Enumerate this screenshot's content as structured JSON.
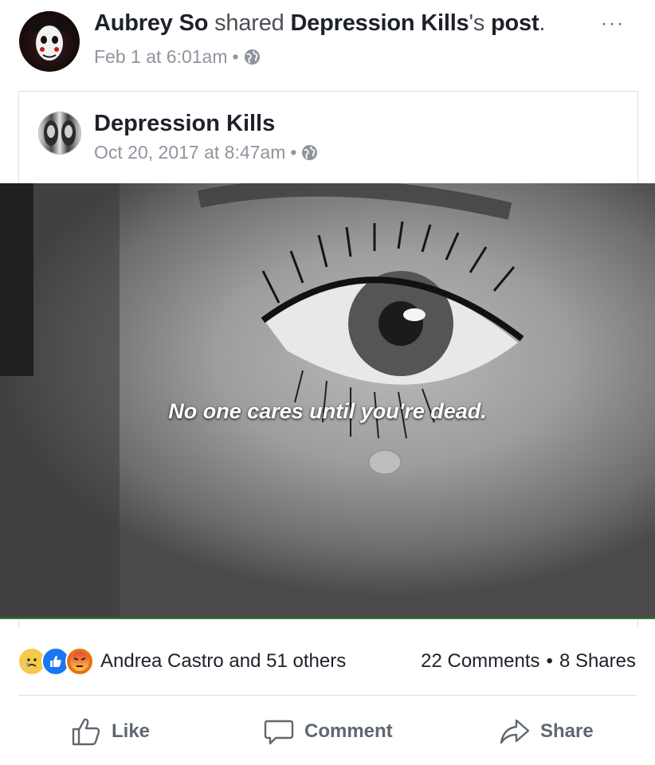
{
  "post": {
    "sharer_name": "Aubrey So",
    "shared_word": "shared",
    "shared_page": "Depression Kills",
    "possessive": "'s",
    "post_word": "post",
    "period": ".",
    "timestamp": "Feb 1 at 6:01am",
    "dot": "•",
    "menu": "···"
  },
  "shared_post": {
    "page_name": "Depression Kills",
    "timestamp": "Oct 20, 2017 at 8:47am",
    "dot": "•",
    "image_caption": "No one cares until you're dead."
  },
  "reactions": {
    "icons": [
      "sad-reaction-icon",
      "like-reaction-icon",
      "angry-reaction-icon"
    ],
    "summary": "Andrea Castro and 51 others",
    "comments": "22 Comments",
    "separator": "•",
    "shares": "8 Shares"
  },
  "actions": {
    "like": "Like",
    "comment": "Comment",
    "share": "Share"
  },
  "colors": {
    "link": "#1d2129",
    "meta": "#90949c",
    "action": "#606770",
    "like_blue": "#1877f2",
    "angry_red": "#e9710f"
  }
}
